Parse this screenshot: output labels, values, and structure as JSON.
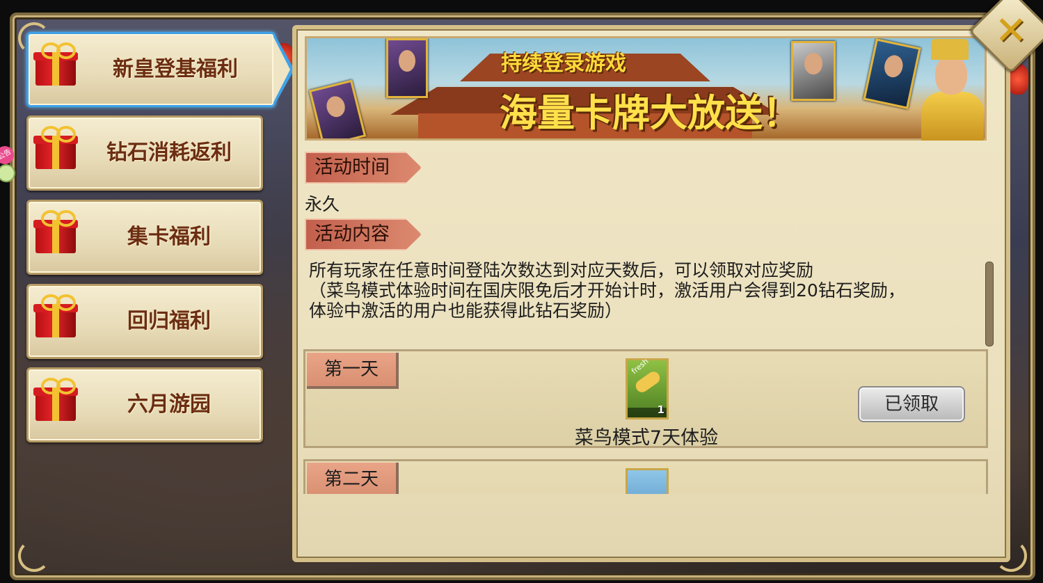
{
  "nav": {
    "tabs": [
      {
        "label": "新皇登基福利",
        "active": true
      },
      {
        "label": "钻石消耗返利",
        "active": false
      },
      {
        "label": "集卡福利",
        "active": false
      },
      {
        "label": "回归福利",
        "active": false
      },
      {
        "label": "六月游园",
        "active": false
      }
    ],
    "notice_tag": "公告"
  },
  "banner": {
    "line1": "持续登录游戏",
    "line2": "海量卡牌大放送！"
  },
  "activity": {
    "time_label": "活动时间",
    "time_value": "永久",
    "content_label": "活动内容",
    "description": [
      "所有玩家在任意时间登陆次数达到对应天数后，可以领取对应奖励",
      "（菜鸟模式体验时间在国庆限免后才开始计时，激活用户会得到20钻石奖励，",
      "体验中激活的用户也能获得此钻石奖励）"
    ]
  },
  "rewards": [
    {
      "day": "第一天",
      "item_badge": "fresh",
      "item_caption": "菜鸟模式",
      "item_count": "1",
      "item_name": "菜鸟模式7天体验",
      "status": "已领取"
    },
    {
      "day": "第二天"
    }
  ],
  "close_icon": "close-icon",
  "colors": {
    "active_tab_border": "#3ea3e8",
    "tab_label": "#6b2d12",
    "section_tag": "#c25f4c"
  }
}
